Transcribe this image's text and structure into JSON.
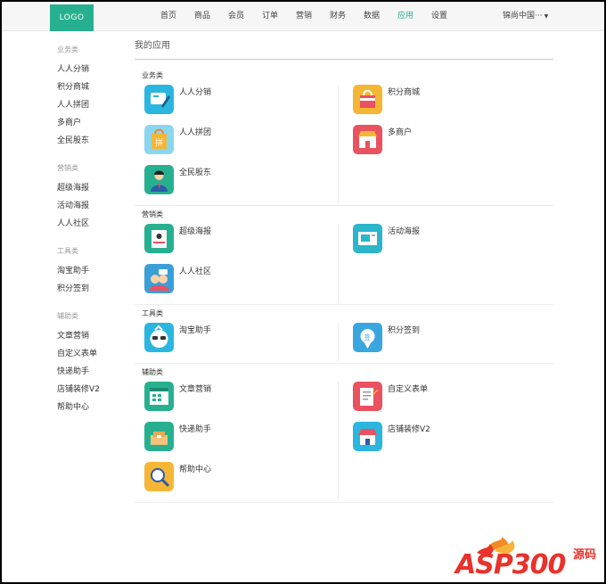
{
  "header": {
    "logo": "LOGO",
    "nav": [
      {
        "label": "首页",
        "active": false
      },
      {
        "label": "商品",
        "active": false
      },
      {
        "label": "会员",
        "active": false
      },
      {
        "label": "订单",
        "active": false
      },
      {
        "label": "营销",
        "active": false
      },
      {
        "label": "财务",
        "active": false
      },
      {
        "label": "数据",
        "active": false
      },
      {
        "label": "应用",
        "active": true
      },
      {
        "label": "设置",
        "active": false
      }
    ],
    "user_menu": "锦尚中国···"
  },
  "sidebar": {
    "groups": [
      {
        "title": "业务类",
        "items": [
          "人人分销",
          "积分商城",
          "人人拼团",
          "多商户",
          "全民股东"
        ]
      },
      {
        "title": "营销类",
        "items": [
          "超级海报",
          "活动海报",
          "人人社区"
        ]
      },
      {
        "title": "工具类",
        "items": [
          "淘宝助手",
          "积分签到"
        ]
      },
      {
        "title": "辅助类",
        "items": [
          "文章营销",
          "自定义表单",
          "快递助手",
          "店铺装修V2",
          "帮助中心"
        ]
      }
    ]
  },
  "main": {
    "title": "我的应用",
    "sections": [
      {
        "title": "业务类",
        "apps": [
          {
            "label": "人人分销",
            "icon": "distribution-icon",
            "color": "#2bb6e0"
          },
          {
            "label": "积分商城",
            "icon": "points-mall-icon",
            "color": "#f6b635"
          },
          {
            "label": "人人拼团",
            "icon": "group-buy-icon",
            "color": "#8ad6ee"
          },
          {
            "label": "多商户",
            "icon": "multi-merchant-icon",
            "color": "#e9525e"
          },
          {
            "label": "全民股东",
            "icon": "shareholder-icon",
            "color": "#27b08f"
          }
        ]
      },
      {
        "title": "营销类",
        "apps": [
          {
            "label": "超级海报",
            "icon": "super-poster-icon",
            "color": "#27b08f"
          },
          {
            "label": "活动海报",
            "icon": "activity-poster-icon",
            "color": "#2bb6c9"
          },
          {
            "label": "人人社区",
            "icon": "community-icon",
            "color": "#3a9fd8"
          }
        ]
      },
      {
        "title": "工具类",
        "apps": [
          {
            "label": "淘宝助手",
            "icon": "taobao-helper-icon",
            "color": "#2bb6e0"
          },
          {
            "label": "积分签到",
            "icon": "points-signin-icon",
            "color": "#3aa6e0"
          }
        ]
      },
      {
        "title": "辅助类",
        "apps": [
          {
            "label": "文章营销",
            "icon": "article-icon",
            "color": "#27b08f"
          },
          {
            "label": "自定义表单",
            "icon": "custom-form-icon",
            "color": "#e9525e"
          },
          {
            "label": "快递助手",
            "icon": "express-icon",
            "color": "#27b08f"
          },
          {
            "label": "店铺装修V2",
            "icon": "shop-decor-icon",
            "color": "#2bb6e0"
          },
          {
            "label": "帮助中心",
            "icon": "help-center-icon",
            "color": "#f6b635"
          }
        ]
      }
    ]
  },
  "watermark": {
    "text": "ASP300",
    "cn": "源码"
  }
}
